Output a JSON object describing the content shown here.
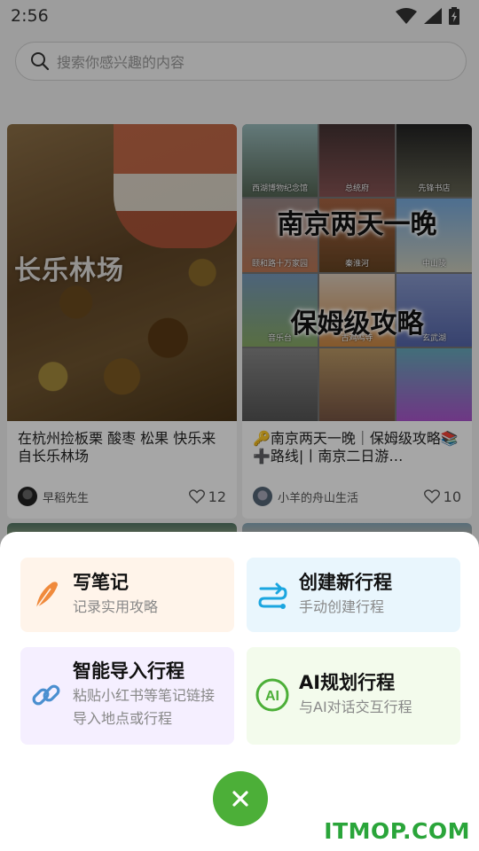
{
  "status_bar": {
    "time": "2:56"
  },
  "search": {
    "placeholder": "搜索你感兴趣的内容"
  },
  "feed": [
    {
      "image_text": "长乐林场",
      "caption": "在杭州捡板栗 酸枣 松果 快乐来自长乐林场",
      "author": "早稻先生",
      "likes": "12"
    },
    {
      "image_title_1": "南京两天一晚",
      "image_title_2": "保姆级攻略",
      "tiles": [
        "西湖博物纪念馆",
        "总统府",
        "先锋书店",
        "颐和路十万家园",
        "秦淮河",
        "中山陵",
        "音乐台",
        "古鸡鸣寺",
        "玄武湖"
      ],
      "caption": "🔑南京两天一晚｜保姆级攻略📚➕路线|丨南京二日游…",
      "author": "小羊的舟山生活",
      "likes": "10"
    }
  ],
  "sheet": {
    "options": [
      {
        "title": "写笔记",
        "subtitle": "记录实用攻略",
        "icon": "feather-icon"
      },
      {
        "title": "创建新行程",
        "subtitle": "手动创建行程",
        "icon": "route-icon"
      },
      {
        "title": "智能导入行程",
        "subtitle": "粘贴小红书等笔记链接导入地点或行程",
        "icon": "link-icon"
      },
      {
        "title": "AI规划行程",
        "subtitle": "与AI对话交互行程",
        "icon": "ai-icon"
      }
    ]
  },
  "watermark": "ITMOP.COM",
  "colors": {
    "accent_green": "#4caf38",
    "watermark_green": "#2aa53a",
    "feather_orange": "#f08a3c",
    "route_blue": "#1ba6e0",
    "link_blue": "#4a8fd0"
  }
}
